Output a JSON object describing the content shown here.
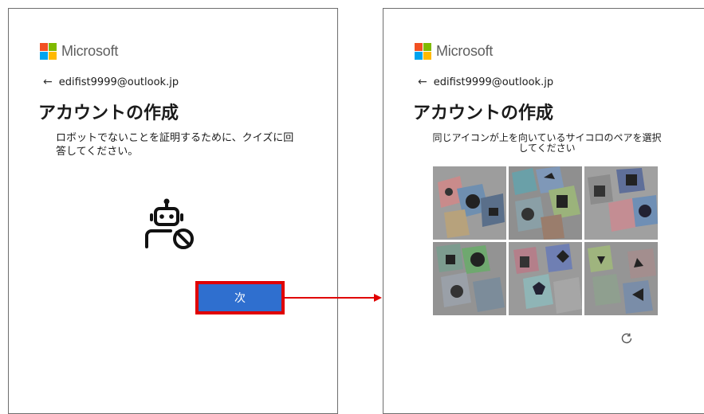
{
  "brand": {
    "name": "Microsoft",
    "colors": [
      "#f25022",
      "#7fba00",
      "#00a4ef",
      "#ffb900"
    ]
  },
  "left_panel": {
    "back_icon": "back-arrow-icon",
    "email": "edifist9999@outlook.jp",
    "title": "アカウントの作成",
    "description": "ロボットでないことを証明するために、クイズに回答してください。",
    "robot_icon": "robot-blocked-icon",
    "next_button": "次",
    "next_button_color": "#2f6fcf",
    "highlight_color": "#e00000"
  },
  "right_panel": {
    "back_icon": "back-arrow-icon",
    "email": "edifist9999@outlook.jp",
    "title": "アカウントの作成",
    "instruction": "同じアイコンが上を向いているサイコロのペアを選択してください",
    "captcha_tiles": [
      {
        "icon": "dice-tile-1"
      },
      {
        "icon": "dice-tile-2"
      },
      {
        "icon": "dice-tile-3"
      },
      {
        "icon": "dice-tile-4"
      },
      {
        "icon": "dice-tile-5"
      },
      {
        "icon": "dice-tile-6"
      }
    ],
    "refresh_icon": "refresh-icon"
  },
  "connector_color": "#e00000"
}
